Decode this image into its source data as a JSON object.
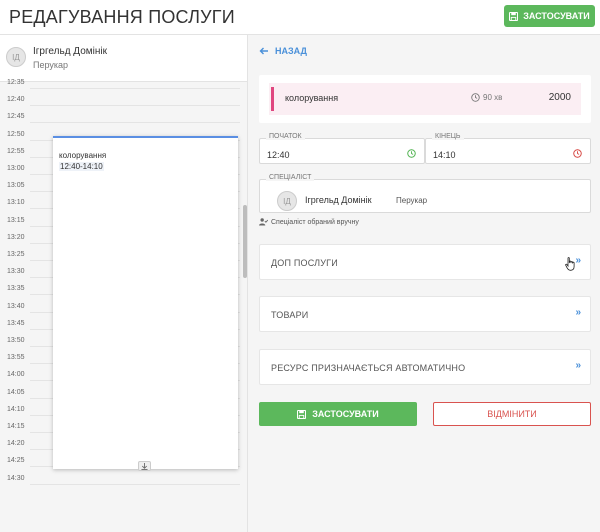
{
  "header": {
    "title": "РЕДАГУВАННЯ ПОСЛУГИ",
    "apply_label": "ЗАСТОСУВАТИ"
  },
  "employee": {
    "initials": "ІД",
    "name": "Ігргельд Домінік",
    "role": "Перукар"
  },
  "timeline": {
    "slots": [
      "12:35",
      "12:40",
      "12:45",
      "12:50",
      "12:55",
      "13:00",
      "13:05",
      "13:10",
      "13:15",
      "13:20",
      "13:25",
      "13:30",
      "13:35",
      "13:40",
      "13:45",
      "13:50",
      "13:55",
      "14:00",
      "14:05",
      "14:10",
      "14:15",
      "14:20",
      "14:25",
      "14:30"
    ]
  },
  "event": {
    "title": "колорування",
    "time": "12:40-14:10"
  },
  "back_label": "НАЗАД",
  "service": {
    "name": "колорування",
    "duration": "90 хв",
    "price": "2000",
    "color": "#e0467f"
  },
  "start": {
    "label": "ПОЧАТОК",
    "value": "12:40"
  },
  "end": {
    "label": "КІНЕЦЬ",
    "value": "14:10"
  },
  "specialist": {
    "label": "СПЕЦІАЛІСТ",
    "initials": "ІД",
    "name": "Ігргельд Домінік",
    "role": "Перукар",
    "note": "Спеціаліст обраний вручну"
  },
  "sections": [
    {
      "label": "ДОП ПОСЛУГИ"
    },
    {
      "label": "ТОВАРИ"
    },
    {
      "label": "РЕСУРС ПРИЗНАЧАЄТЬСЯ АВТОМАТИЧНО"
    }
  ],
  "actions": {
    "apply_label": "ЗАСТОСУВАТИ",
    "cancel_label": "ВІДМІНИТИ"
  },
  "colors": {
    "accent_green": "#5cb85c",
    "accent_blue": "#4a90d9",
    "cancel_red": "#d9534f",
    "event_border": "#5b8fe3"
  }
}
